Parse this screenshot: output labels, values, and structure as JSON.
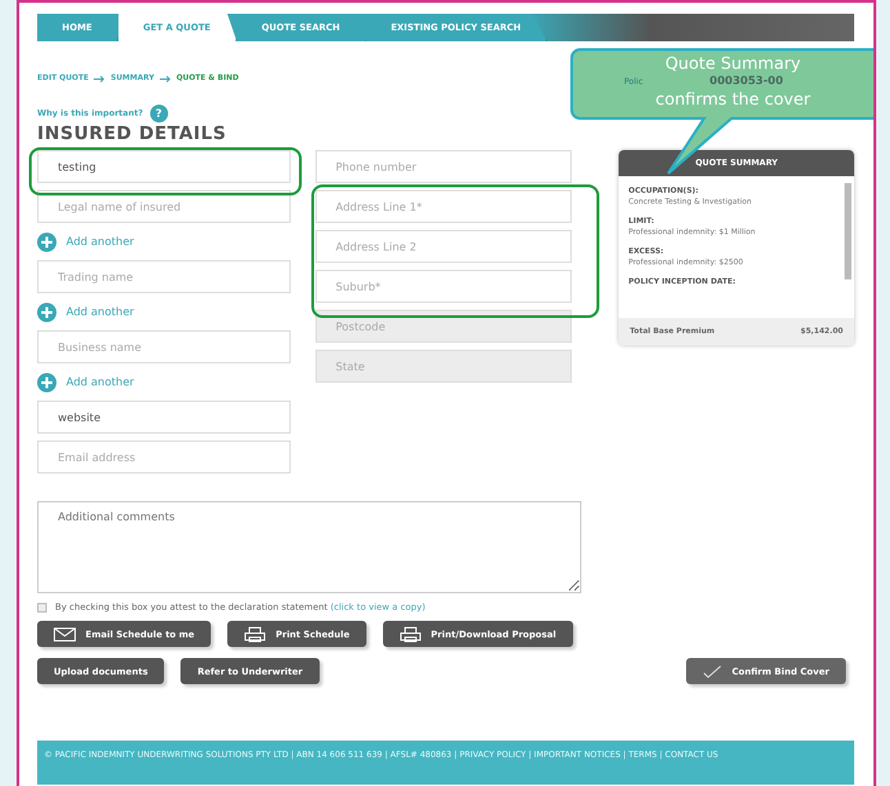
{
  "tabs": [
    {
      "label": "HOME",
      "selected": false
    },
    {
      "label": "GET A QUOTE",
      "selected": true
    },
    {
      "label": "QUOTE SEARCH",
      "selected": false
    },
    {
      "label": "EXISTING POLICY SEARCH",
      "selected": false
    }
  ],
  "breadcrumb": [
    {
      "label": "EDIT QUOTE",
      "selected": false
    },
    {
      "label": "SUMMARY",
      "selected": false
    },
    {
      "label": "QUOTE & BIND",
      "selected": true
    }
  ],
  "policy_number": {
    "label": "Polic",
    "value": "0003053-00"
  },
  "help_link": "Why is this important?",
  "help_icon": "?",
  "section_title": "INSURED DETAILS",
  "left_fields": [
    {
      "kind": "field",
      "value": "testing",
      "highlighted": true
    },
    {
      "kind": "field",
      "placeholder": "Legal name of insured"
    },
    {
      "kind": "add",
      "label": "Add another"
    },
    {
      "kind": "field",
      "placeholder": "Trading name"
    },
    {
      "kind": "add",
      "label": "Add another"
    },
    {
      "kind": "field",
      "placeholder": "Business name"
    },
    {
      "kind": "add",
      "label": "Add another"
    },
    {
      "kind": "field",
      "value": "website"
    },
    {
      "kind": "field",
      "placeholder": "Email address"
    }
  ],
  "right_fields": [
    {
      "placeholder": "Phone number",
      "disabled": false,
      "highlighted": false
    },
    {
      "placeholder": "Address Line 1*",
      "disabled": false,
      "highlighted": true
    },
    {
      "placeholder": "Address Line 2",
      "disabled": false,
      "highlighted": true
    },
    {
      "placeholder": "Suburb*",
      "disabled": false,
      "highlighted": true
    },
    {
      "placeholder": "Postcode",
      "disabled": true,
      "highlighted": false
    },
    {
      "placeholder": "State",
      "disabled": true,
      "highlighted": false
    }
  ],
  "summary": {
    "title": "QUOTE SUMMARY",
    "sections": [
      {
        "heading": "OCCUPATION(S):",
        "text": "Concrete Testing & Investigation"
      },
      {
        "heading": "LIMIT:",
        "text": "Professional indemnity: $1 Million"
      },
      {
        "heading": "EXCESS:",
        "text": "Professional indemnity: $2500"
      },
      {
        "heading": "POLICY INCEPTION DATE:"
      }
    ],
    "total_label": "Total Base Premium",
    "total_value": "$5,142.00"
  },
  "comments": {
    "placeholder": "Additional comments"
  },
  "declaration": {
    "checked": false,
    "text": "By checking this box you attest to the declaration statement",
    "link": "(click to view a copy)"
  },
  "button_rows": [
    [
      {
        "label": "Email Schedule to me"
      },
      {
        "label": "Print Schedule"
      },
      {
        "label": "Print/Download Proposal"
      }
    ],
    [
      {
        "label": "Upload documents"
      },
      {
        "label": "Refer to Underwriter"
      }
    ]
  ],
  "confirm_button": {
    "label": "Confirm Bind Cover"
  },
  "callout": {
    "lines": [
      "Quote Summary",
      "confirms the cover"
    ]
  },
  "footer": "© PACIFIC INDEMNITY UNDERWRITING SOLUTIONS PTY LTD | ABN 14 606 511 639 | AFSL# 480863 | PRIVACY POLICY | IMPORTANT NOTICES | TERMS | CONTACT US"
}
